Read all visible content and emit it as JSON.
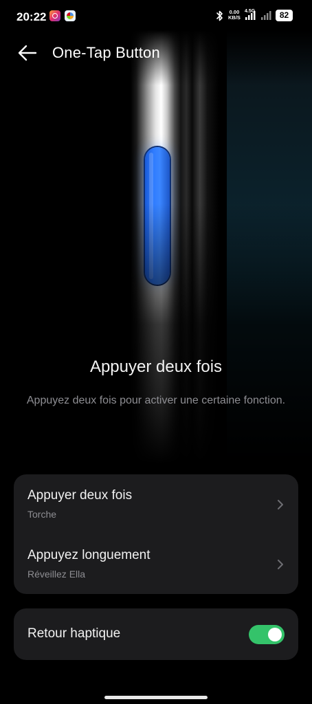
{
  "status_bar": {
    "time": "20:22",
    "net_speed_value": "0.00",
    "net_speed_unit": "KB/S",
    "network_type": "4.5G",
    "battery": "82",
    "icons": [
      "instagram-icon",
      "gallery-icon",
      "bluetooth-icon",
      "signal-icon",
      "signal-icon",
      "battery-icon"
    ]
  },
  "header": {
    "title": "One-Tap Button",
    "back_icon": "arrow-left-icon"
  },
  "feature": {
    "title": "Appuyer deux fois",
    "description": "Appuyez deux fois pour activer une certaine fonction."
  },
  "settings": {
    "actions": [
      {
        "label": "Appuyer deux fois",
        "value": "Torche"
      },
      {
        "label": "Appuyez longuement",
        "value": "Réveillez Ella"
      }
    ],
    "haptic": {
      "label": "Retour haptique",
      "enabled": true
    }
  },
  "colors": {
    "accent_blue": "#2f7cff",
    "toggle_on": "#34c36a",
    "card_bg": "#1c1c1e",
    "secondary_text": "#8e8e93"
  }
}
